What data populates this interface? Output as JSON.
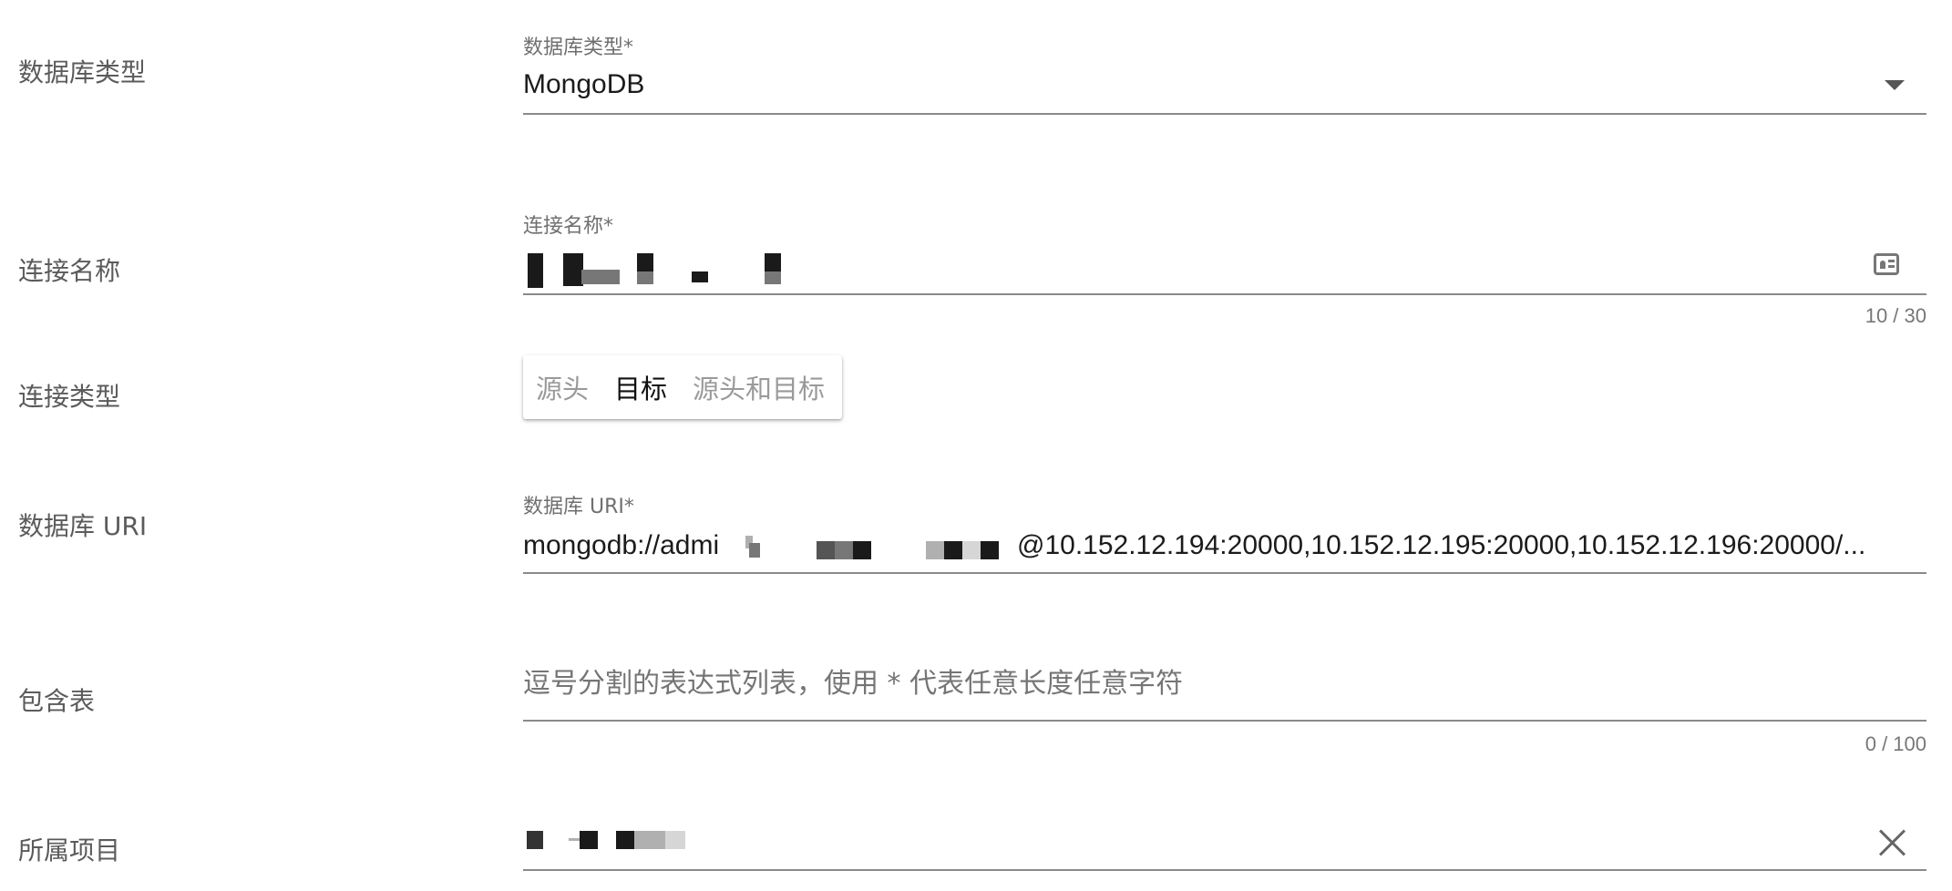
{
  "rows": {
    "db_type": {
      "label": "数据库类型",
      "float_label": "数据库类型*",
      "value": "MongoDB",
      "icon": "dropdown-arrow-icon"
    },
    "conn_name": {
      "label": "连接名称",
      "float_label": "连接名称*",
      "counter": "10 / 30",
      "icon": "id-card-icon"
    },
    "conn_type": {
      "label": "连接类型",
      "options": [
        "源头",
        "目标",
        "源头和目标"
      ],
      "selected": "目标"
    },
    "db_uri": {
      "label": "数据库 URI",
      "float_label": "数据库 URI*",
      "value_prefix": "mongodb://admi",
      "value_suffix": "@10.152.12.194:20000,10.152.12.195:20000,10.152.12.196:20000/..."
    },
    "include_tables": {
      "label": "包含表",
      "placeholder": "逗号分割的表达式列表，使用 * 代表任意长度任意字符",
      "counter": "0 / 100"
    },
    "project": {
      "label": "所属项目",
      "icon": "close-icon"
    }
  }
}
